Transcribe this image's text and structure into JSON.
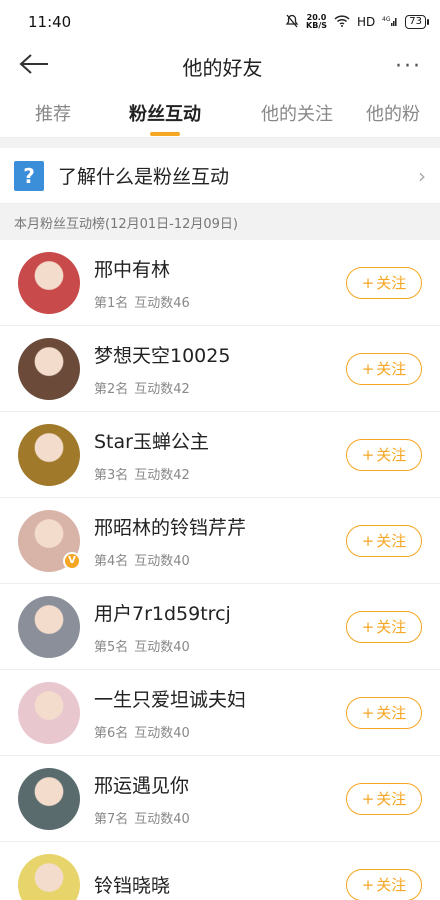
{
  "status": {
    "time": "11:40",
    "net_speed_value": "20.0",
    "net_speed_unit": "KB/S",
    "network": "HD",
    "signal": "4G",
    "battery": "73"
  },
  "nav": {
    "title": "他的好友",
    "more": "···"
  },
  "tabs": [
    {
      "label": "推荐"
    },
    {
      "label": "粉丝互动"
    },
    {
      "label": "他的关注"
    },
    {
      "label": "他的粉"
    }
  ],
  "info": {
    "icon_char": "?",
    "text": "了解什么是粉丝互动",
    "chevron": "›"
  },
  "rank_header": "本月粉丝互动榜(12月01日-12月09日)",
  "follow_label": "关注",
  "follow_plus": "+",
  "users": [
    {
      "name": "邢中有林",
      "rank": "第1名",
      "count": "互动数46",
      "avatar_color": "#c94a4a"
    },
    {
      "name": "梦想天空10025",
      "rank": "第2名",
      "count": "互动数42",
      "avatar_color": "#6b4a3a"
    },
    {
      "name": "Star玉蝉公主",
      "rank": "第3名",
      "count": "互动数42",
      "avatar_color": "#a07a2a"
    },
    {
      "name": "邢昭林的铃铛芹芹",
      "rank": "第4名",
      "count": "互动数40",
      "avatar_color": "#d8b3a8",
      "verified": "V"
    },
    {
      "name": "用户7r1d59trcj",
      "rank": "第5名",
      "count": "互动数40",
      "avatar_color": "#8a8f99"
    },
    {
      "name": "一生只爱坦诚夫妇",
      "rank": "第6名",
      "count": "互动数40",
      "avatar_color": "#e9c7cf"
    },
    {
      "name": "邢运遇见你",
      "rank": "第7名",
      "count": "互动数40",
      "avatar_color": "#5a6b6e"
    },
    {
      "name": "铃铛晓晓",
      "rank": "",
      "count": "",
      "avatar_color": "#e7d46a"
    }
  ],
  "colors": {
    "accent": "#f5a623",
    "info_icon": "#3b8ed8"
  }
}
